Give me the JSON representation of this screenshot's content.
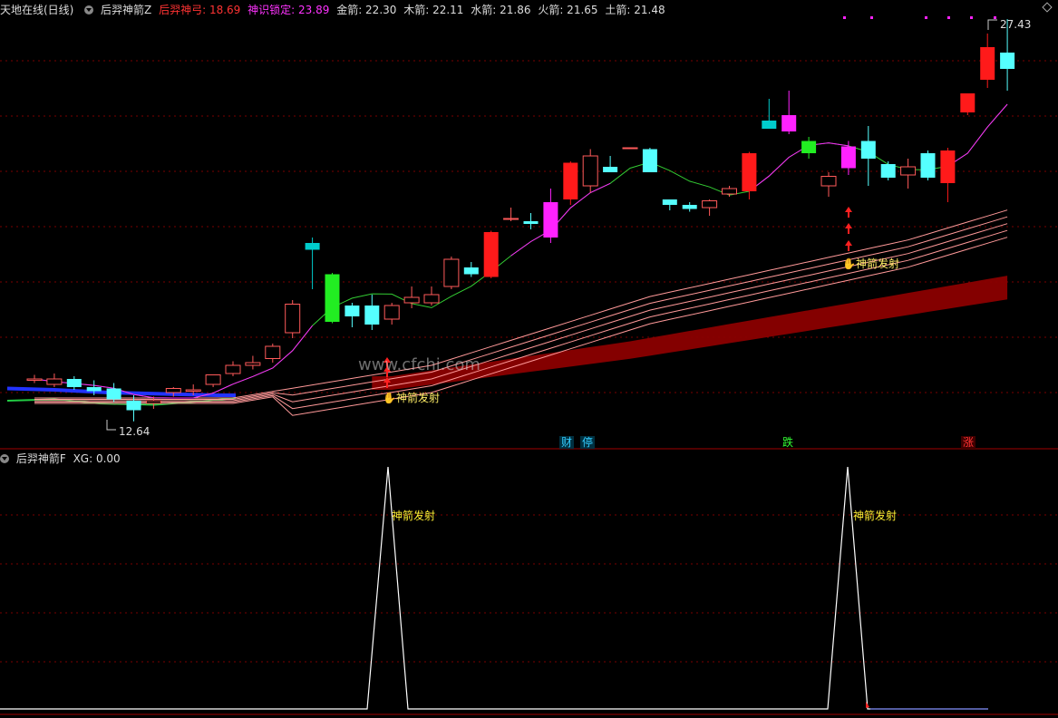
{
  "top_panel": {
    "app_title": "天地在线(日线)",
    "indicator_name": "后羿神箭Z",
    "values": [
      {
        "label": "后羿神弓: 18.69",
        "color": "#ff3333"
      },
      {
        "label": "神识锁定: 23.89",
        "color": "#ff33ff"
      },
      {
        "label": "金箭: 22.30",
        "color": "#dddddd"
      },
      {
        "label": "木箭: 22.11",
        "color": "#dddddd"
      },
      {
        "label": "水箭: 21.86",
        "color": "#dddddd"
      },
      {
        "label": "火箭: 21.65",
        "color": "#dddddd"
      },
      {
        "label": "土箭: 21.48",
        "color": "#dddddd"
      }
    ],
    "high_price": "27.43",
    "low_price": "12.64",
    "signal_label": "神箭发射",
    "watermark": "www.cfchi.com",
    "badges": [
      {
        "text": "财",
        "color": "#33ccff"
      },
      {
        "text": "停",
        "color": "#33ccff"
      },
      {
        "text": "跌",
        "color": "#33ff33"
      },
      {
        "text": "涨",
        "color": "#ff3333"
      }
    ]
  },
  "bottom_panel": {
    "indicator_name": "后羿神箭F",
    "values_label": "XG: 0.00",
    "signal_label": "神箭发射"
  },
  "colors": {
    "up": "#ff1a1a",
    "down": "#55ffff",
    "magenta": "#ff22ff",
    "green": "#22ee22",
    "teal": "#00cccc",
    "band": "#8b0000",
    "grid": "#7a0000"
  },
  "chart_data": {
    "type": "candlestick",
    "title": "天地在线(日线)",
    "price_high_label": 27.43,
    "price_low_label": 12.64,
    "candles": [
      {
        "o": 14.15,
        "h": 14.35,
        "l": 14.05,
        "c": 14.2,
        "t": "up_hollow"
      },
      {
        "o": 14.2,
        "h": 14.4,
        "l": 13.9,
        "c": 14.0,
        "t": "up_hollow"
      },
      {
        "o": 14.2,
        "h": 14.3,
        "l": 13.8,
        "c": 13.9,
        "t": "down"
      },
      {
        "o": 13.9,
        "h": 14.15,
        "l": 13.6,
        "c": 13.75,
        "t": "down"
      },
      {
        "o": 13.85,
        "h": 14.05,
        "l": 13.35,
        "c": 13.45,
        "t": "down"
      },
      {
        "o": 13.4,
        "h": 13.6,
        "l": 12.64,
        "c": 13.05,
        "t": "down"
      },
      {
        "o": 13.3,
        "h": 13.55,
        "l": 13.1,
        "c": 13.4,
        "t": "up_hollow"
      },
      {
        "o": 13.7,
        "h": 13.9,
        "l": 13.55,
        "c": 13.85,
        "t": "up_hollow"
      },
      {
        "o": 13.8,
        "h": 14.0,
        "l": 13.6,
        "c": 13.75,
        "t": "up_hollow"
      },
      {
        "o": 14.0,
        "h": 14.3,
        "l": 13.9,
        "c": 14.35,
        "t": "up_hollow"
      },
      {
        "o": 14.4,
        "h": 14.85,
        "l": 14.3,
        "c": 14.7,
        "t": "up_hollow"
      },
      {
        "o": 14.7,
        "h": 15.05,
        "l": 14.55,
        "c": 14.8,
        "t": "up_hollow"
      },
      {
        "o": 14.95,
        "h": 15.5,
        "l": 14.8,
        "c": 15.4,
        "t": "up_hollow"
      },
      {
        "o": 15.9,
        "h": 17.1,
        "l": 15.7,
        "c": 16.95,
        "t": "up_hollow"
      },
      {
        "o": 19.2,
        "h": 19.4,
        "l": 17.5,
        "c": 18.95,
        "t": "teal"
      },
      {
        "o": 16.3,
        "h": 18.1,
        "l": 16.25,
        "c": 18.05,
        "t": "green"
      },
      {
        "o": 16.9,
        "h": 17.0,
        "l": 16.1,
        "c": 16.5,
        "t": "down"
      },
      {
        "o": 16.9,
        "h": 17.3,
        "l": 16.0,
        "c": 16.2,
        "t": "down"
      },
      {
        "o": 16.4,
        "h": 17.0,
        "l": 16.2,
        "c": 16.9,
        "t": "up_hollow"
      },
      {
        "o": 17.0,
        "h": 17.6,
        "l": 16.8,
        "c": 17.2,
        "t": "up_hollow"
      },
      {
        "o": 17.0,
        "h": 17.6,
        "l": 16.9,
        "c": 17.3,
        "t": "up_hollow"
      },
      {
        "o": 17.6,
        "h": 18.7,
        "l": 17.5,
        "c": 18.6,
        "t": "up_hollow"
      },
      {
        "o": 18.3,
        "h": 18.5,
        "l": 17.95,
        "c": 18.05,
        "t": "down"
      },
      {
        "o": 17.95,
        "h": 19.65,
        "l": 17.9,
        "c": 19.6,
        "t": "up"
      },
      {
        "o": 20.1,
        "h": 20.5,
        "l": 20.0,
        "c": 20.1,
        "t": "up_hollow"
      },
      {
        "o": 20.0,
        "h": 20.3,
        "l": 19.7,
        "c": 19.9,
        "t": "down"
      },
      {
        "o": 19.4,
        "h": 21.2,
        "l": 19.2,
        "c": 20.7,
        "t": "magenta"
      },
      {
        "o": 20.8,
        "h": 22.2,
        "l": 20.6,
        "c": 22.15,
        "t": "up"
      },
      {
        "o": 21.3,
        "h": 22.65,
        "l": 21.05,
        "c": 22.4,
        "t": "up_hollow"
      },
      {
        "o": 22.0,
        "h": 22.4,
        "l": 21.8,
        "c": 21.8,
        "t": "down"
      },
      {
        "o": 22.7,
        "h": 22.7,
        "l": 22.7,
        "c": 22.7,
        "t": "up_hollow"
      },
      {
        "o": 22.65,
        "h": 22.7,
        "l": 21.8,
        "c": 21.8,
        "t": "down"
      },
      {
        "o": 20.8,
        "h": 20.8,
        "l": 20.4,
        "c": 20.6,
        "t": "down"
      },
      {
        "o": 20.6,
        "h": 20.7,
        "l": 20.35,
        "c": 20.45,
        "t": "down"
      },
      {
        "o": 20.5,
        "h": 20.8,
        "l": 20.2,
        "c": 20.75,
        "t": "up_hollow"
      },
      {
        "o": 21.0,
        "h": 21.3,
        "l": 20.9,
        "c": 21.2,
        "t": "up_hollow"
      },
      {
        "o": 21.1,
        "h": 22.55,
        "l": 20.8,
        "c": 22.5,
        "t": "up"
      },
      {
        "o": 23.7,
        "h": 24.5,
        "l": 23.4,
        "c": 23.4,
        "t": "teal"
      },
      {
        "o": 23.3,
        "h": 24.8,
        "l": 23.2,
        "c": 23.9,
        "t": "magenta"
      },
      {
        "o": 22.5,
        "h": 23.1,
        "l": 22.3,
        "c": 22.95,
        "t": "green"
      },
      {
        "o": 21.3,
        "h": 21.8,
        "l": 20.9,
        "c": 21.65,
        "t": "up_hollow"
      },
      {
        "o": 22.75,
        "h": 22.95,
        "l": 21.7,
        "c": 21.95,
        "t": "magenta"
      },
      {
        "o": 22.95,
        "h": 23.5,
        "l": 21.3,
        "c": 22.3,
        "t": "down"
      },
      {
        "o": 22.1,
        "h": 22.2,
        "l": 21.5,
        "c": 21.6,
        "t": "down"
      },
      {
        "o": 21.7,
        "h": 22.3,
        "l": 21.2,
        "c": 22.0,
        "t": "up_hollow"
      },
      {
        "o": 22.5,
        "h": 22.6,
        "l": 21.5,
        "c": 21.6,
        "t": "down"
      },
      {
        "o": 21.4,
        "h": 22.7,
        "l": 20.7,
        "c": 22.6,
        "t": "up"
      },
      {
        "o": 24.0,
        "h": 24.7,
        "l": 23.9,
        "c": 24.7,
        "t": "up"
      },
      {
        "o": 25.2,
        "h": 26.9,
        "l": 24.9,
        "c": 26.4,
        "t": "up"
      },
      {
        "o": 25.6,
        "h": 27.43,
        "l": 24.8,
        "c": 26.2,
        "t": "down"
      }
    ],
    "signal_candles": [
      19,
      42
    ],
    "xg_series": "0 except spikes to 1 at candles 19 and 42"
  }
}
